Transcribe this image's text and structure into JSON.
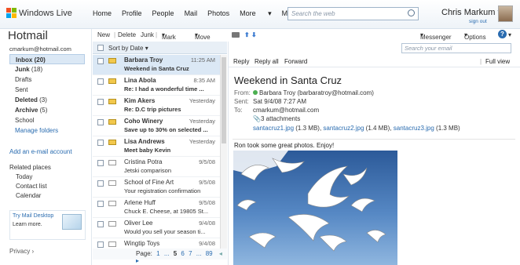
{
  "topbar": {
    "brand": "Windows Live",
    "nav": [
      "Home",
      "Profile",
      "People",
      "Mail",
      "Photos",
      "More",
      "MSN"
    ],
    "search_placeholder": "Search the web",
    "user_name": "Chris Markum",
    "sign_out": "sign out"
  },
  "sidebar": {
    "title": "Hotmail",
    "account": "cmarkum@hotmail.com",
    "folders": [
      {
        "label": "Inbox",
        "count": "(20)"
      },
      {
        "label": "Junk",
        "count": "(18)"
      },
      {
        "label": "Drafts",
        "count": ""
      },
      {
        "label": "Sent",
        "count": ""
      },
      {
        "label": "Deleted",
        "count": "(3)"
      },
      {
        "label": "Archive",
        "count": "(5)"
      },
      {
        "label": "School",
        "count": ""
      }
    ],
    "manage_folders": "Manage folders",
    "add_account": "Add an e-mail account",
    "related_title": "Related places",
    "related": [
      "Today",
      "Contact list",
      "Calendar"
    ],
    "promo_title": "Try Mail Desktop",
    "promo_link": "Learn more.",
    "privacy": "Privacy"
  },
  "toolbar": {
    "new": "New",
    "delete": "Delete",
    "junk": "Junk",
    "mark_as": "Mark as",
    "move_to": "Move to",
    "messenger": "Messenger",
    "options": "Options"
  },
  "list": {
    "sort_label": "Sort by Date",
    "messages": [
      {
        "from": "Barbara Troy",
        "subject": "Weekend in Santa Cruz",
        "date": "11:25 AM",
        "unread": true,
        "selected": true
      },
      {
        "from": "Lina Abola",
        "subject": "Re: I had a wonderful time ...",
        "date": "8:35 AM",
        "unread": true,
        "selected": false
      },
      {
        "from": "Kim Akers",
        "subject": "Re: D.C trip pictures",
        "date": "Yesterday",
        "unread": true,
        "selected": false
      },
      {
        "from": "Coho Winery",
        "subject": "Save up to 30% on selected ...",
        "date": "Yesterday",
        "unread": true,
        "selected": false
      },
      {
        "from": "Lisa Andrews",
        "subject": "Meet baby Kevin",
        "date": "Yesterday",
        "unread": true,
        "selected": false
      },
      {
        "from": "Cristina Potra",
        "subject": "Jetski comparison",
        "date": "9/5/08",
        "unread": false,
        "selected": false
      },
      {
        "from": "School of Fine Art",
        "subject": "Your registration confirmation",
        "date": "9/5/08",
        "unread": false,
        "selected": false
      },
      {
        "from": "Arlene Huff",
        "subject": "Chuck E. Cheese, at 19805 St...",
        "date": "9/5/08",
        "unread": false,
        "selected": false
      },
      {
        "from": "Oliver Lee",
        "subject": "Would you sell your season ti...",
        "date": "9/4/08",
        "unread": false,
        "selected": false
      },
      {
        "from": "Wingtip Toys",
        "subject": "Buy rabbit from Christfun...",
        "date": "9/4/08",
        "unread": false,
        "selected": false
      }
    ],
    "pager_label": "Page:",
    "pages": [
      "1",
      "...",
      "5",
      "6",
      "7",
      "...",
      "89"
    ],
    "current_page": "5"
  },
  "reading": {
    "search_placeholder": "Search your email",
    "reply": "Reply",
    "reply_all": "Reply all",
    "forward": "Forward",
    "full_view": "Full view",
    "subject": "Weekend in Santa Cruz",
    "from_label": "From:",
    "from": "Barbara Troy (barbaratroy@hotmail.com)",
    "sent_label": "Sent:",
    "sent": "Sat 9/4/08 7:27 AM",
    "to_label": "To:",
    "to": "cmarkum@hotmail.com",
    "attachments_label": "3 attachments",
    "attachments": [
      {
        "name": "santacruz1.jpg",
        "size": "(1.3 MB)"
      },
      {
        "name": "santacruz2.jpg",
        "size": "(1.4 MB)"
      },
      {
        "name": "santacruz3.jpg",
        "size": "(1.3 MB)"
      }
    ],
    "body": "Ron took some great photos. Enjoy!"
  },
  "colors": {
    "accent": "#2a6cb0",
    "selection": "#dbe8f5",
    "unread_env": "#f2c84c"
  }
}
